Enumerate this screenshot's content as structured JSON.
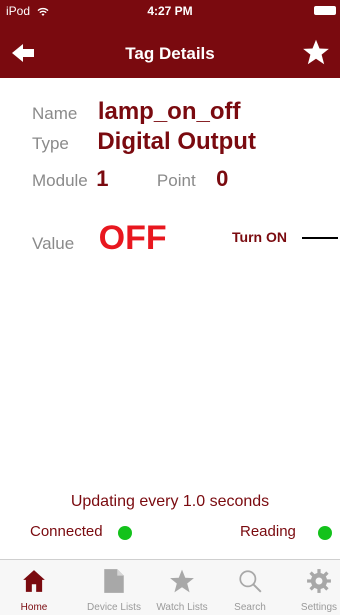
{
  "status_bar": {
    "carrier": "iPod",
    "time": "4:27 PM"
  },
  "nav": {
    "title": "Tag Details",
    "back_icon": "back-arrow-icon",
    "star_icon": "star-icon"
  },
  "tag": {
    "name_label": "Name",
    "name_value": "lamp_on_off",
    "type_label": "Type",
    "type_value": "Digital Output",
    "module_label": "Module",
    "module_value": "1",
    "point_label": "Point",
    "point_value": "0",
    "value_label": "Value",
    "value_value": "OFF",
    "action_label": "Turn ON"
  },
  "footer": {
    "updating_text": "Updating every 1.0 seconds",
    "connected_label": "Connected",
    "reading_label": "Reading",
    "status_color": "#13c21b"
  },
  "tabs": [
    {
      "label": "Home",
      "icon": "home-icon",
      "active": true
    },
    {
      "label": "Device Lists",
      "icon": "document-icon",
      "active": false
    },
    {
      "label": "Watch Lists",
      "icon": "star-icon",
      "active": false
    },
    {
      "label": "Search",
      "icon": "search-icon",
      "active": false
    },
    {
      "label": "Settings",
      "icon": "gear-icon",
      "active": false
    }
  ],
  "colors": {
    "brand": "#7a0a0f",
    "off": "#e8171f"
  }
}
